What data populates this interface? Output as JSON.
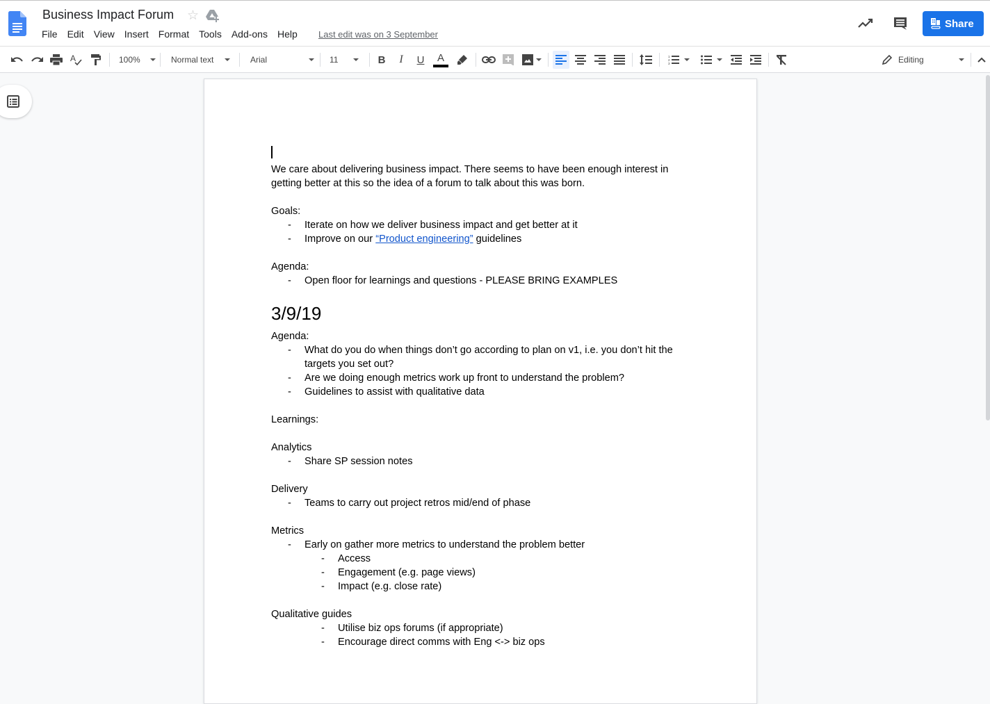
{
  "app": {
    "doc_title": "Business Impact Forum",
    "last_edit": "Last edit was on 3 September",
    "menu": [
      "File",
      "Edit",
      "View",
      "Insert",
      "Format",
      "Tools",
      "Add-ons",
      "Help"
    ],
    "share_label": "Share",
    "colors": {
      "accent": "#1a73e8",
      "link": "#1155cc",
      "doc_icon": "#4285f4"
    }
  },
  "toolbar": {
    "zoom": "100%",
    "style": "Normal text",
    "font": "Arial",
    "font_size": "11",
    "mode": "Editing",
    "icons": [
      "undo-icon",
      "redo-icon",
      "print-icon",
      "spellcheck-icon",
      "paint-format-icon",
      "bold-icon",
      "italic-icon",
      "underline-icon",
      "text-color-icon",
      "highlight-icon",
      "link-icon",
      "add-comment-icon",
      "insert-image-icon",
      "align-left-icon",
      "align-center-icon",
      "align-right-icon",
      "justify-icon",
      "line-spacing-icon",
      "numbered-list-icon",
      "bulleted-list-icon",
      "decrease-indent-icon",
      "increase-indent-icon",
      "clear-formatting-icon"
    ]
  },
  "document": {
    "intro": "We care about delivering business impact. There seems to have been enough interest in getting better at this so the idea of a forum to talk about this was born.",
    "goals_label": "Goals:",
    "goals": [
      "Iterate on how we deliver business impact and get better at it"
    ],
    "goal2_prefix": "Improve on our ",
    "goal2_link": "“Product engineering”",
    "goal2_suffix": " guidelines",
    "agenda_label": "Agenda:",
    "agenda": [
      "Open floor for learnings and questions - PLEASE BRING EXAMPLES"
    ],
    "section_heading": "3/9/19",
    "section_agenda_label": "Agenda:",
    "section_agenda": [
      "What do you do when things don’t go according to plan on v1, i.e. you don’t hit the targets you set out?",
      "Are we doing enough metrics work up front to understand the problem?",
      "Guidelines to assist with qualitative data"
    ],
    "learnings_label": "Learnings:",
    "analytics_label": "Analytics",
    "analytics": [
      "Share SP session notes"
    ],
    "delivery_label": "Delivery",
    "delivery": [
      "Teams to carry out project retros mid/end of phase"
    ],
    "metrics_label": "Metrics",
    "metrics": [
      "Early on gather more metrics to understand the problem better"
    ],
    "metrics_sub": [
      "Access",
      "Engagement (e.g. page views)",
      "Impact (e.g. close rate)"
    ],
    "qualitative_label": "Qualitative guides",
    "qualitative_sub": [
      "Utilise biz ops forums (if appropriate)",
      "Encourage direct comms with Eng <-> biz ops"
    ],
    "bullet": "-"
  }
}
